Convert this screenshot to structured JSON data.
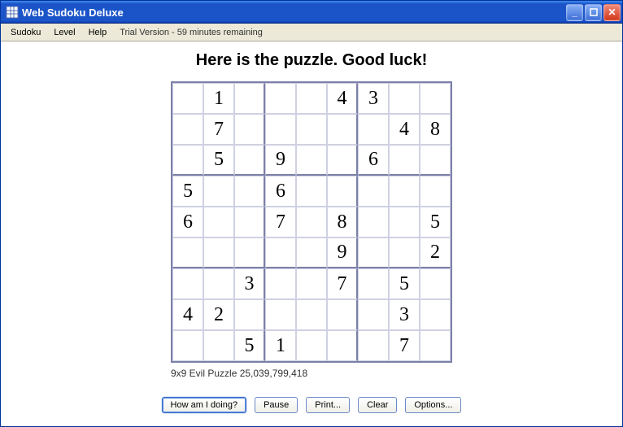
{
  "window": {
    "title": "Web Sudoku Deluxe"
  },
  "menu": {
    "items": [
      "Sudoku",
      "Level",
      "Help"
    ],
    "trial_text": "Trial Version - 59 minutes remaining"
  },
  "heading": "Here is the puzzle. Good luck!",
  "puzzle_info": "9x9 Evil Puzzle 25,039,799,418",
  "buttons": {
    "how": "How am I doing?",
    "pause": "Pause",
    "print": "Print...",
    "clear": "Clear",
    "options": "Options..."
  },
  "sudoku": {
    "grid": [
      [
        "",
        "1",
        "",
        "",
        "",
        "4",
        "3",
        "",
        ""
      ],
      [
        "",
        "7",
        "",
        "",
        "",
        "",
        "",
        "4",
        "8"
      ],
      [
        "",
        "5",
        "",
        "9",
        "",
        "",
        "6",
        "",
        ""
      ],
      [
        "5",
        "",
        "",
        "6",
        "",
        "",
        "",
        "",
        ""
      ],
      [
        "6",
        "",
        "",
        "7",
        "",
        "8",
        "",
        "",
        "5"
      ],
      [
        "",
        "",
        "",
        "",
        "",
        "9",
        "",
        "",
        "2"
      ],
      [
        "",
        "",
        "3",
        "",
        "",
        "7",
        "",
        "5",
        ""
      ],
      [
        "4",
        "2",
        "",
        "",
        "",
        "",
        "",
        "3",
        ""
      ],
      [
        "",
        "",
        "5",
        "1",
        "",
        "",
        "",
        "7",
        ""
      ]
    ]
  }
}
